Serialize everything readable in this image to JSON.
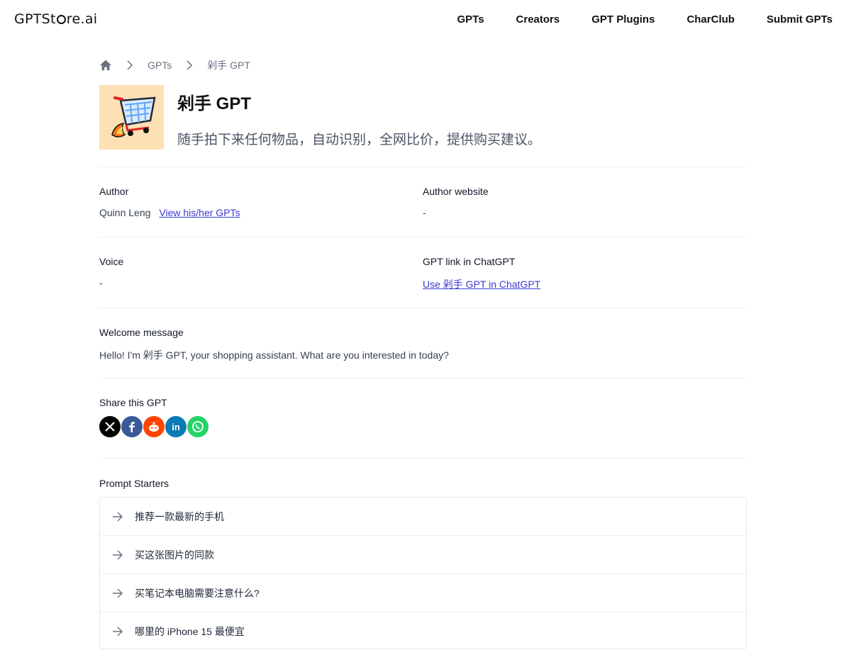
{
  "header": {
    "logo_prefix": "GPTSt",
    "logo_suffix": "re.ai",
    "nav": [
      {
        "label": "GPTs"
      },
      {
        "label": "Creators"
      },
      {
        "label": "GPT Plugins"
      },
      {
        "label": "CharClub"
      },
      {
        "label": "Submit GPTs"
      }
    ]
  },
  "breadcrumb": {
    "home_icon": "home-icon",
    "items": [
      "GPTs",
      "剁手 GPT"
    ]
  },
  "gpt": {
    "name": "剁手 GPT",
    "description": "随手拍下来任何物品，自动识别，全网比价，提供购买建议。",
    "icon": "shopping-cart-rocket-icon"
  },
  "details": {
    "author_label": "Author",
    "author_name": "Quinn Leng",
    "author_link": "View his/her GPTs",
    "website_label": "Author website",
    "website_value": "-",
    "voice_label": "Voice",
    "voice_value": "-",
    "chatgpt_label": "GPT link in ChatGPT",
    "chatgpt_link": "Use 剁手 GPT in ChatGPT",
    "welcome_label": "Welcome message",
    "welcome_value": "Hello! I'm 剁手 GPT, your shopping assistant. What are you interested in today?"
  },
  "share": {
    "label": "Share this GPT",
    "buttons": [
      {
        "icon": "x-icon",
        "color": "#000000"
      },
      {
        "icon": "facebook-icon",
        "color": "#3b5998"
      },
      {
        "icon": "reddit-icon",
        "color": "#ff4500"
      },
      {
        "icon": "linkedin-icon",
        "color": "#0a7bb4"
      },
      {
        "icon": "whatsapp-icon",
        "color": "#25d366"
      }
    ]
  },
  "prompt_starters": {
    "label": "Prompt Starters",
    "items": [
      "推荐一款最新的手机",
      "买这张图片的同款",
      "买笔记本电脑需要注意什么?",
      "哪里的 iPhone 15 最便宜"
    ]
  }
}
